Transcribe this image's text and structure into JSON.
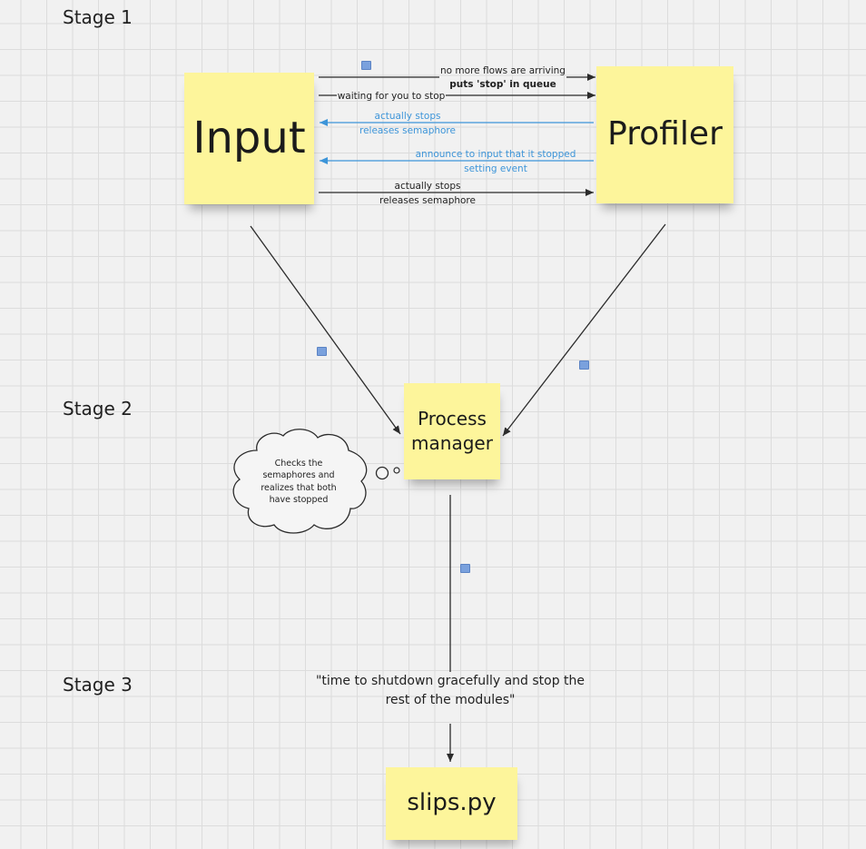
{
  "stages": {
    "stage1": "Stage 1",
    "stage2": "Stage 2",
    "stage3": "Stage 3"
  },
  "notes": {
    "input": "Input",
    "profiler": "Profiler",
    "process_manager": "Process manager",
    "slips": "slips.py"
  },
  "arrows": {
    "a1_line1": "no more flows are arriving",
    "a1_line2": "puts 'stop' in queue",
    "a2": "waiting for you to stop",
    "a3_line1": "actually stops",
    "a3_line2": "releases semaphore",
    "a4_line1": "announce to input that it stopped",
    "a4_line2": "setting event",
    "a5_line1": "actually stops",
    "a5_line2": "releases semaphore"
  },
  "thought": {
    "line1": "Checks the",
    "line2": "semaphores and",
    "line3": "realizes that both",
    "line4": "have stopped"
  },
  "quote": {
    "line1": "\"time to shutdown gracefully and stop the",
    "line2": "rest of the modules\""
  },
  "colors": {
    "note": "#fdf59b",
    "blue_arrow": "#3d95d9",
    "dark_arrow": "#2b2b2b",
    "badge": "#7aa1dd"
  }
}
